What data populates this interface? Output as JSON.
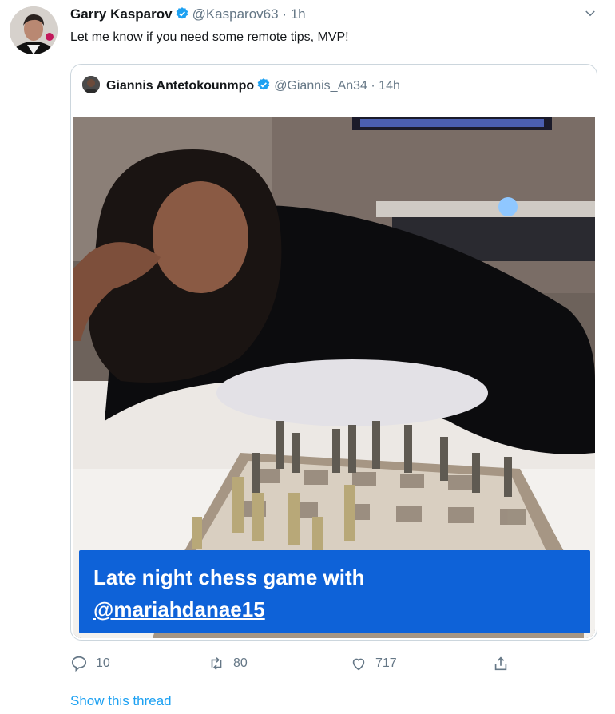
{
  "tweet": {
    "author_name": "Garry Kasparov",
    "author_handle": "@Kasparov63",
    "time": "· 1h",
    "text": "Let me know if you need some remote tips, MVP!"
  },
  "quoted": {
    "author_name": "Giannis Antetokounmpo",
    "author_handle": "@Giannis_An34",
    "time": "· 14h",
    "caption_line1": "Late night chess game with",
    "caption_mention": "@mariahdanae15"
  },
  "actions": {
    "replies": "10",
    "retweets": "80",
    "likes": "717"
  },
  "footer": {
    "show_thread": "Show this thread"
  },
  "colors": {
    "link": "#1da1f2",
    "caption_bg": "#0e62d8",
    "verified": "#1da1f2"
  },
  "icons": [
    "verified-badge-icon",
    "chevron-down-icon",
    "reply-icon",
    "retweet-icon",
    "like-icon",
    "share-icon"
  ]
}
